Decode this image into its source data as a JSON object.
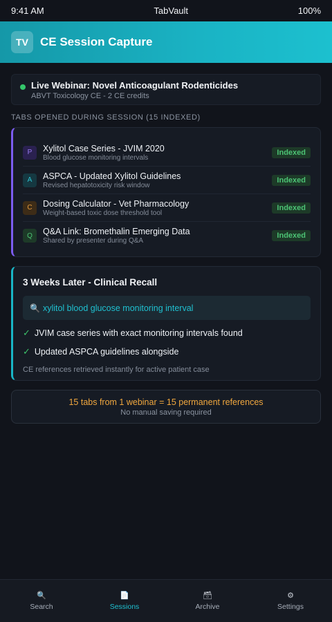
{
  "status_bar": {
    "time": "9:41 AM",
    "app_name": "TabVault",
    "battery": "100%"
  },
  "header": {
    "logo_text": "TV",
    "title": "CE Session Capture"
  },
  "webinar": {
    "title": "Live Webinar: Novel Anticoagulant Rodenticides",
    "subtitle": "ABVT Toxicology CE - 2 CE credits",
    "status_color": "#34c66b"
  },
  "tabs_section": {
    "label": "TABS OPENED DURING SESSION (15 INDEXED)",
    "items": [
      {
        "letter": "P",
        "title": "Xylitol Case Series - JVIM 2020",
        "desc": "Blood glucose monitoring intervals",
        "badge": "Indexed",
        "icon_bg": "#2a2150",
        "icon_fg": "#9a7cf2"
      },
      {
        "letter": "A",
        "title": "ASPCA - Updated Xylitol Guidelines",
        "desc": "Revised hepatotoxicity risk window",
        "badge": "Indexed",
        "icon_bg": "#153841",
        "icon_fg": "#2ec0d0"
      },
      {
        "letter": "C",
        "title": "Dosing Calculator - Vet Pharmacology",
        "desc": "Weight-based toxic dose threshold tool",
        "badge": "Indexed",
        "icon_bg": "#3d2c17",
        "icon_fg": "#e29b3e"
      },
      {
        "letter": "Q",
        "title": "Q&A Link: Bromethalin Emerging Data",
        "desc": "Shared by presenter during Q&A",
        "badge": "Indexed",
        "icon_bg": "#1d3a28",
        "icon_fg": "#4cc274"
      }
    ]
  },
  "recall": {
    "title": "3 Weeks Later - Clinical Recall",
    "search_icon": "magnifier-icon",
    "search_text": "xylitol blood glucose monitoring interval",
    "results": [
      "JVIM case series with exact monitoring intervals found",
      "Updated ASPCA guidelines alongside"
    ],
    "footnote": "CE references retrieved instantly for active patient case"
  },
  "summary": {
    "main": "15 tabs from 1 webinar = 15 permanent references",
    "sub": "No manual saving required"
  },
  "nav": [
    {
      "label": "Search",
      "icon": "🔍",
      "icon_name": "search-icon",
      "active": false
    },
    {
      "label": "Sessions",
      "icon": "📄",
      "icon_name": "document-icon",
      "active": true
    },
    {
      "label": "Archive",
      "icon": "🗃",
      "icon_name": "archive-icon",
      "active": false
    },
    {
      "label": "Settings",
      "icon": "⚙",
      "icon_name": "gear-icon",
      "active": false
    }
  ],
  "colors": {
    "accent": "#1fc0d0",
    "tabs_border": "#7c5cf0",
    "recall_border": "#19b6c6",
    "summary_text": "#f0a73e"
  }
}
